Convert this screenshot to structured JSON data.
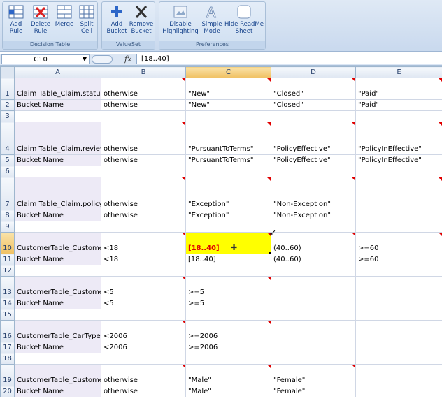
{
  "ribbon": {
    "groups": [
      {
        "title": "Decision Table",
        "buttons": [
          {
            "label1": "Add",
            "label2": "Rule",
            "icon": "add-rule-icon"
          },
          {
            "label1": "Delete",
            "label2": "Rule",
            "icon": "delete-rule-icon"
          },
          {
            "label1": "Merge",
            "label2": "",
            "icon": "merge-icon"
          },
          {
            "label1": "Split",
            "label2": "Cell",
            "icon": "split-cell-icon"
          }
        ]
      },
      {
        "title": "ValueSet",
        "buttons": [
          {
            "label1": "Add",
            "label2": "Bucket",
            "icon": "plus-icon"
          },
          {
            "label1": "Remove",
            "label2": "Bucket",
            "icon": "x-icon"
          }
        ]
      },
      {
        "title": "Preferences",
        "buttons": [
          {
            "label1": "Disable",
            "label2": "Highlighting",
            "icon": "highlight-icon"
          },
          {
            "label1": "Simple",
            "label2": "Mode",
            "icon": "simple-mode-icon"
          },
          {
            "label1": "Hide ReadMe",
            "label2": "Sheet",
            "icon": "readme-icon"
          }
        ]
      }
    ]
  },
  "formula_bar": {
    "cell_ref": "C10",
    "fx": "fx",
    "value": "[18..40]"
  },
  "columns": [
    "A",
    "B",
    "C",
    "D",
    "E"
  ],
  "rows": [
    {
      "num": "1",
      "a": "Claim Table_Claim.status",
      "b": "otherwise",
      "c": "\"New\"",
      "d": "\"Closed\"",
      "e": "\"Paid\""
    },
    {
      "num": "2",
      "a": "Bucket Name",
      "b": "otherwise",
      "c": "\"New\"",
      "d": "\"Closed\"",
      "e": "\"Paid\""
    },
    {
      "num": "3",
      "a": "",
      "b": "",
      "c": "",
      "d": "",
      "e": ""
    },
    {
      "num": "4",
      "a": "Claim Table_Claim.reviewDetails",
      "b": "otherwise",
      "c": "\"PursuantToTerms\"",
      "d": "\"PolicyEffective\"",
      "e": "\"PolicyInEffective\""
    },
    {
      "num": "5",
      "a": "Bucket Name",
      "b": "otherwise",
      "c": "\"PursuantToTerms\"",
      "d": "\"PolicyEffective\"",
      "e": "\"PolicyInEffective\""
    },
    {
      "num": "6",
      "a": "",
      "b": "",
      "c": "",
      "d": "",
      "e": ""
    },
    {
      "num": "7",
      "a": "Claim Table_Claim.policy.terms.generalTerms",
      "b": "otherwise",
      "c": "\"Exception\"",
      "d": "\"Non-Exception\"",
      "e": ""
    },
    {
      "num": "8",
      "a": "Bucket Name",
      "b": "otherwise",
      "c": "\"Exception\"",
      "d": "\"Non-Exception\"",
      "e": ""
    },
    {
      "num": "9",
      "a": "",
      "b": "",
      "c": "",
      "d": "",
      "e": ""
    },
    {
      "num": "10",
      "a": "CustomerTable_Customer.age",
      "b": "<18",
      "c": "[18..40]",
      "d": "(40..60)",
      "e": ">=60"
    },
    {
      "num": "11",
      "a": "Bucket Name",
      "b": "<18",
      "c": "[18..40]",
      "d": "(40..60)",
      "e": ">=60"
    },
    {
      "num": "12",
      "a": "",
      "b": "",
      "c": "",
      "d": "",
      "e": ""
    },
    {
      "num": "13",
      "a": "CustomerTable_Customer.drivingExperience",
      "b": "<5",
      "c": ">=5",
      "d": "",
      "e": ""
    },
    {
      "num": "14",
      "a": "Bucket Name",
      "b": "<5",
      "c": ">=5",
      "d": "",
      "e": ""
    },
    {
      "num": "15",
      "a": "",
      "b": "",
      "c": "",
      "d": "",
      "e": ""
    },
    {
      "num": "16",
      "a": "CustomerTable_CarType.year",
      "b": "<2006",
      "c": ">=2006",
      "d": "",
      "e": ""
    },
    {
      "num": "17",
      "a": "Bucket Name",
      "b": "<2006",
      "c": ">=2006",
      "d": "",
      "e": ""
    },
    {
      "num": "18",
      "a": "",
      "b": "",
      "c": "",
      "d": "",
      "e": ""
    },
    {
      "num": "19",
      "a": "CustomerTable_Customer.sex",
      "b": "otherwise",
      "c": "\"Male\"",
      "d": "\"Female\"",
      "e": ""
    },
    {
      "num": "20",
      "a": "Bucket Name",
      "b": "otherwise",
      "c": "\"Male\"",
      "d": "\"Female\"",
      "e": ""
    }
  ],
  "selected_cell": "C10",
  "colors": {
    "selection_fill": "#ffff00",
    "label_fill": "#edeaf6",
    "comment_marker": "#e00000"
  }
}
